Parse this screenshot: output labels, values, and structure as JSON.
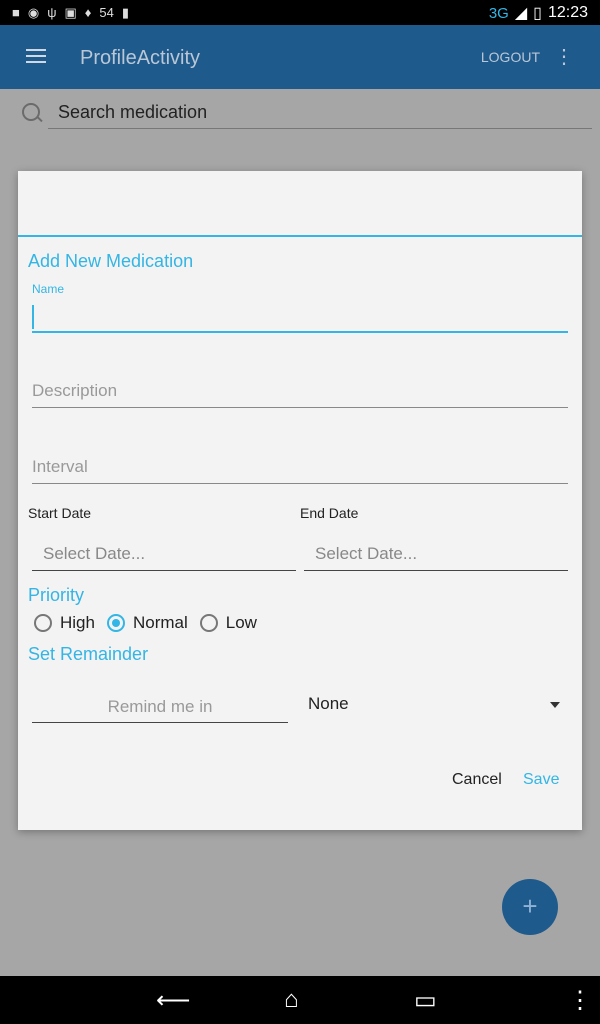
{
  "statusbar": {
    "left_icons": [
      "f-icon",
      "messenger-icon",
      "usb-icon",
      "gift-icon",
      "twitter-icon",
      "54",
      "bars-icon"
    ],
    "network": "3G",
    "time": "12:23"
  },
  "toolbar": {
    "title": "ProfileActivity",
    "logout_label": "LOGOUT"
  },
  "search": {
    "placeholder": "Search medication"
  },
  "dialog": {
    "title": "Add New Medication",
    "name_label": "Name",
    "name_value": "",
    "description_placeholder": "Description",
    "interval_placeholder": "Interval",
    "start_date_label": "Start Date",
    "end_date_label": "End Date",
    "start_date_placeholder": "Select Date...",
    "end_date_placeholder": "Select Date...",
    "priority_heading": "Priority",
    "priority_options": [
      "High",
      "Normal",
      "Low"
    ],
    "priority_selected": "Normal",
    "set_reminder_heading": "Set Remainder",
    "remind_placeholder": "Remind me in",
    "remind_select_value": "None",
    "cancel_label": "Cancel",
    "save_label": "Save"
  },
  "fab": {
    "label": "+"
  },
  "colors": {
    "accent": "#33b5e5",
    "toolbar": "#1f5a8c"
  }
}
